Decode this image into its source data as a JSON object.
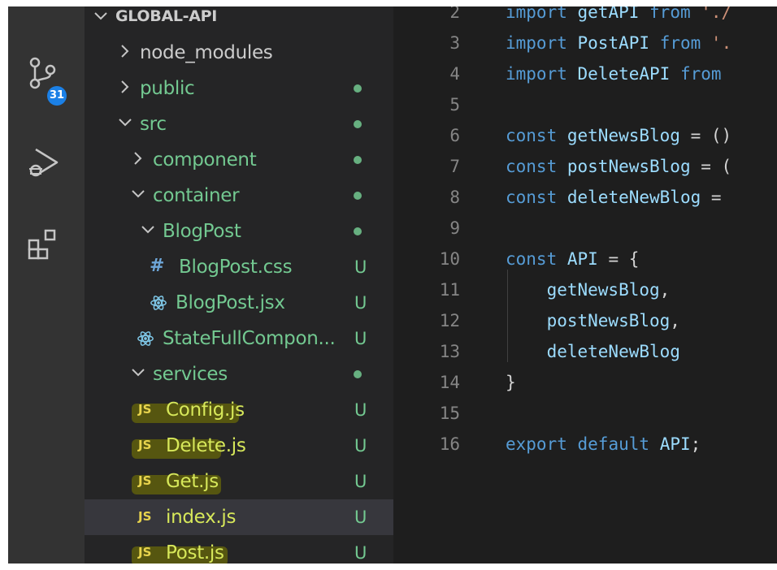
{
  "activity_bar": {
    "icons": [
      "source-control-icon",
      "run-debug-icon",
      "extensions-icon"
    ],
    "source_control_badge": "31"
  },
  "explorer": {
    "root_label": "GLOBAL-API",
    "items": [
      {
        "label": "node_modules",
        "type": "folder",
        "state": "collapsed",
        "status": ""
      },
      {
        "label": "public",
        "type": "folder",
        "state": "collapsed",
        "status": "dot"
      },
      {
        "label": "src",
        "type": "folder",
        "state": "expanded",
        "status": "dot"
      },
      {
        "label": "component",
        "type": "folder",
        "state": "collapsed",
        "status": "dot"
      },
      {
        "label": "container",
        "type": "folder",
        "state": "expanded",
        "status": "dot"
      },
      {
        "label": "BlogPost",
        "type": "folder",
        "state": "expanded",
        "status": "dot"
      },
      {
        "label": "BlogPost.css",
        "type": "css",
        "status": "U"
      },
      {
        "label": "BlogPost.jsx",
        "type": "jsx",
        "status": "U"
      },
      {
        "label": "StateFullCompon...",
        "type": "jsx",
        "status": "U"
      },
      {
        "label": "services",
        "type": "folder",
        "state": "expanded",
        "status": "dot"
      },
      {
        "label": "Config.js",
        "type": "js",
        "status": "U",
        "icon_text": "JS"
      },
      {
        "label": "Delete.js",
        "type": "js",
        "status": "U",
        "icon_text": "JS"
      },
      {
        "label": "Get.js",
        "type": "js",
        "status": "U",
        "icon_text": "JS"
      },
      {
        "label": "index.js",
        "type": "js",
        "status": "U",
        "icon_text": "JS",
        "selected": true
      },
      {
        "label": "Post.js",
        "type": "js",
        "status": "U",
        "icon_text": "JS"
      }
    ]
  },
  "editor": {
    "lines": [
      {
        "n": "2",
        "tokens": [
          {
            "t": "kw",
            "v": "import"
          },
          {
            "t": "plain",
            "v": " "
          },
          {
            "t": "id",
            "v": "getAPI"
          },
          {
            "t": "plain",
            "v": " "
          },
          {
            "t": "kw",
            "v": "from"
          },
          {
            "t": "plain",
            "v": " "
          },
          {
            "t": "str",
            "v": "'./"
          }
        ]
      },
      {
        "n": "3",
        "tokens": [
          {
            "t": "kw",
            "v": "import"
          },
          {
            "t": "plain",
            "v": " "
          },
          {
            "t": "id",
            "v": "PostAPI"
          },
          {
            "t": "plain",
            "v": " "
          },
          {
            "t": "kw",
            "v": "from"
          },
          {
            "t": "plain",
            "v": " "
          },
          {
            "t": "str",
            "v": "'."
          }
        ]
      },
      {
        "n": "4",
        "tokens": [
          {
            "t": "kw",
            "v": "import"
          },
          {
            "t": "plain",
            "v": " "
          },
          {
            "t": "id",
            "v": "DeleteAPI"
          },
          {
            "t": "plain",
            "v": " "
          },
          {
            "t": "kw",
            "v": "from"
          }
        ]
      },
      {
        "n": "5",
        "tokens": []
      },
      {
        "n": "6",
        "tokens": [
          {
            "t": "kw",
            "v": "const"
          },
          {
            "t": "plain",
            "v": " "
          },
          {
            "t": "id",
            "v": "getNewsBlog"
          },
          {
            "t": "plain",
            "v": " = ()"
          }
        ]
      },
      {
        "n": "7",
        "tokens": [
          {
            "t": "kw",
            "v": "const"
          },
          {
            "t": "plain",
            "v": " "
          },
          {
            "t": "id",
            "v": "postNewsBlog"
          },
          {
            "t": "plain",
            "v": " = ("
          }
        ]
      },
      {
        "n": "8",
        "tokens": [
          {
            "t": "kw",
            "v": "const"
          },
          {
            "t": "plain",
            "v": " "
          },
          {
            "t": "id",
            "v": "deleteNewBlog"
          },
          {
            "t": "plain",
            "v": " ="
          }
        ]
      },
      {
        "n": "9",
        "tokens": []
      },
      {
        "n": "10",
        "tokens": [
          {
            "t": "kw",
            "v": "const"
          },
          {
            "t": "plain",
            "v": " "
          },
          {
            "t": "id",
            "v": "API"
          },
          {
            "t": "plain",
            "v": " = {"
          }
        ]
      },
      {
        "n": "11",
        "tokens": [
          {
            "t": "plain",
            "v": "    "
          },
          {
            "t": "id",
            "v": "getNewsBlog"
          },
          {
            "t": "plain",
            "v": ","
          }
        ]
      },
      {
        "n": "12",
        "tokens": [
          {
            "t": "plain",
            "v": "    "
          },
          {
            "t": "id",
            "v": "postNewsBlog"
          },
          {
            "t": "plain",
            "v": ","
          }
        ]
      },
      {
        "n": "13",
        "tokens": [
          {
            "t": "plain",
            "v": "    "
          },
          {
            "t": "id",
            "v": "deleteNewBlog"
          }
        ]
      },
      {
        "n": "14",
        "tokens": [
          {
            "t": "plain",
            "v": "}"
          }
        ]
      },
      {
        "n": "15",
        "tokens": []
      },
      {
        "n": "16",
        "tokens": [
          {
            "t": "kw",
            "v": "export"
          },
          {
            "t": "plain",
            "v": " "
          },
          {
            "t": "kw",
            "v": "default"
          },
          {
            "t": "plain",
            "v": " "
          },
          {
            "t": "id",
            "v": "API"
          },
          {
            "t": "plain",
            "v": ";"
          }
        ]
      }
    ]
  },
  "colors": {
    "keyword": "#569cd6",
    "identifier": "#9cdcfe",
    "untracked": "#73c991",
    "highlight": "#58580f"
  }
}
